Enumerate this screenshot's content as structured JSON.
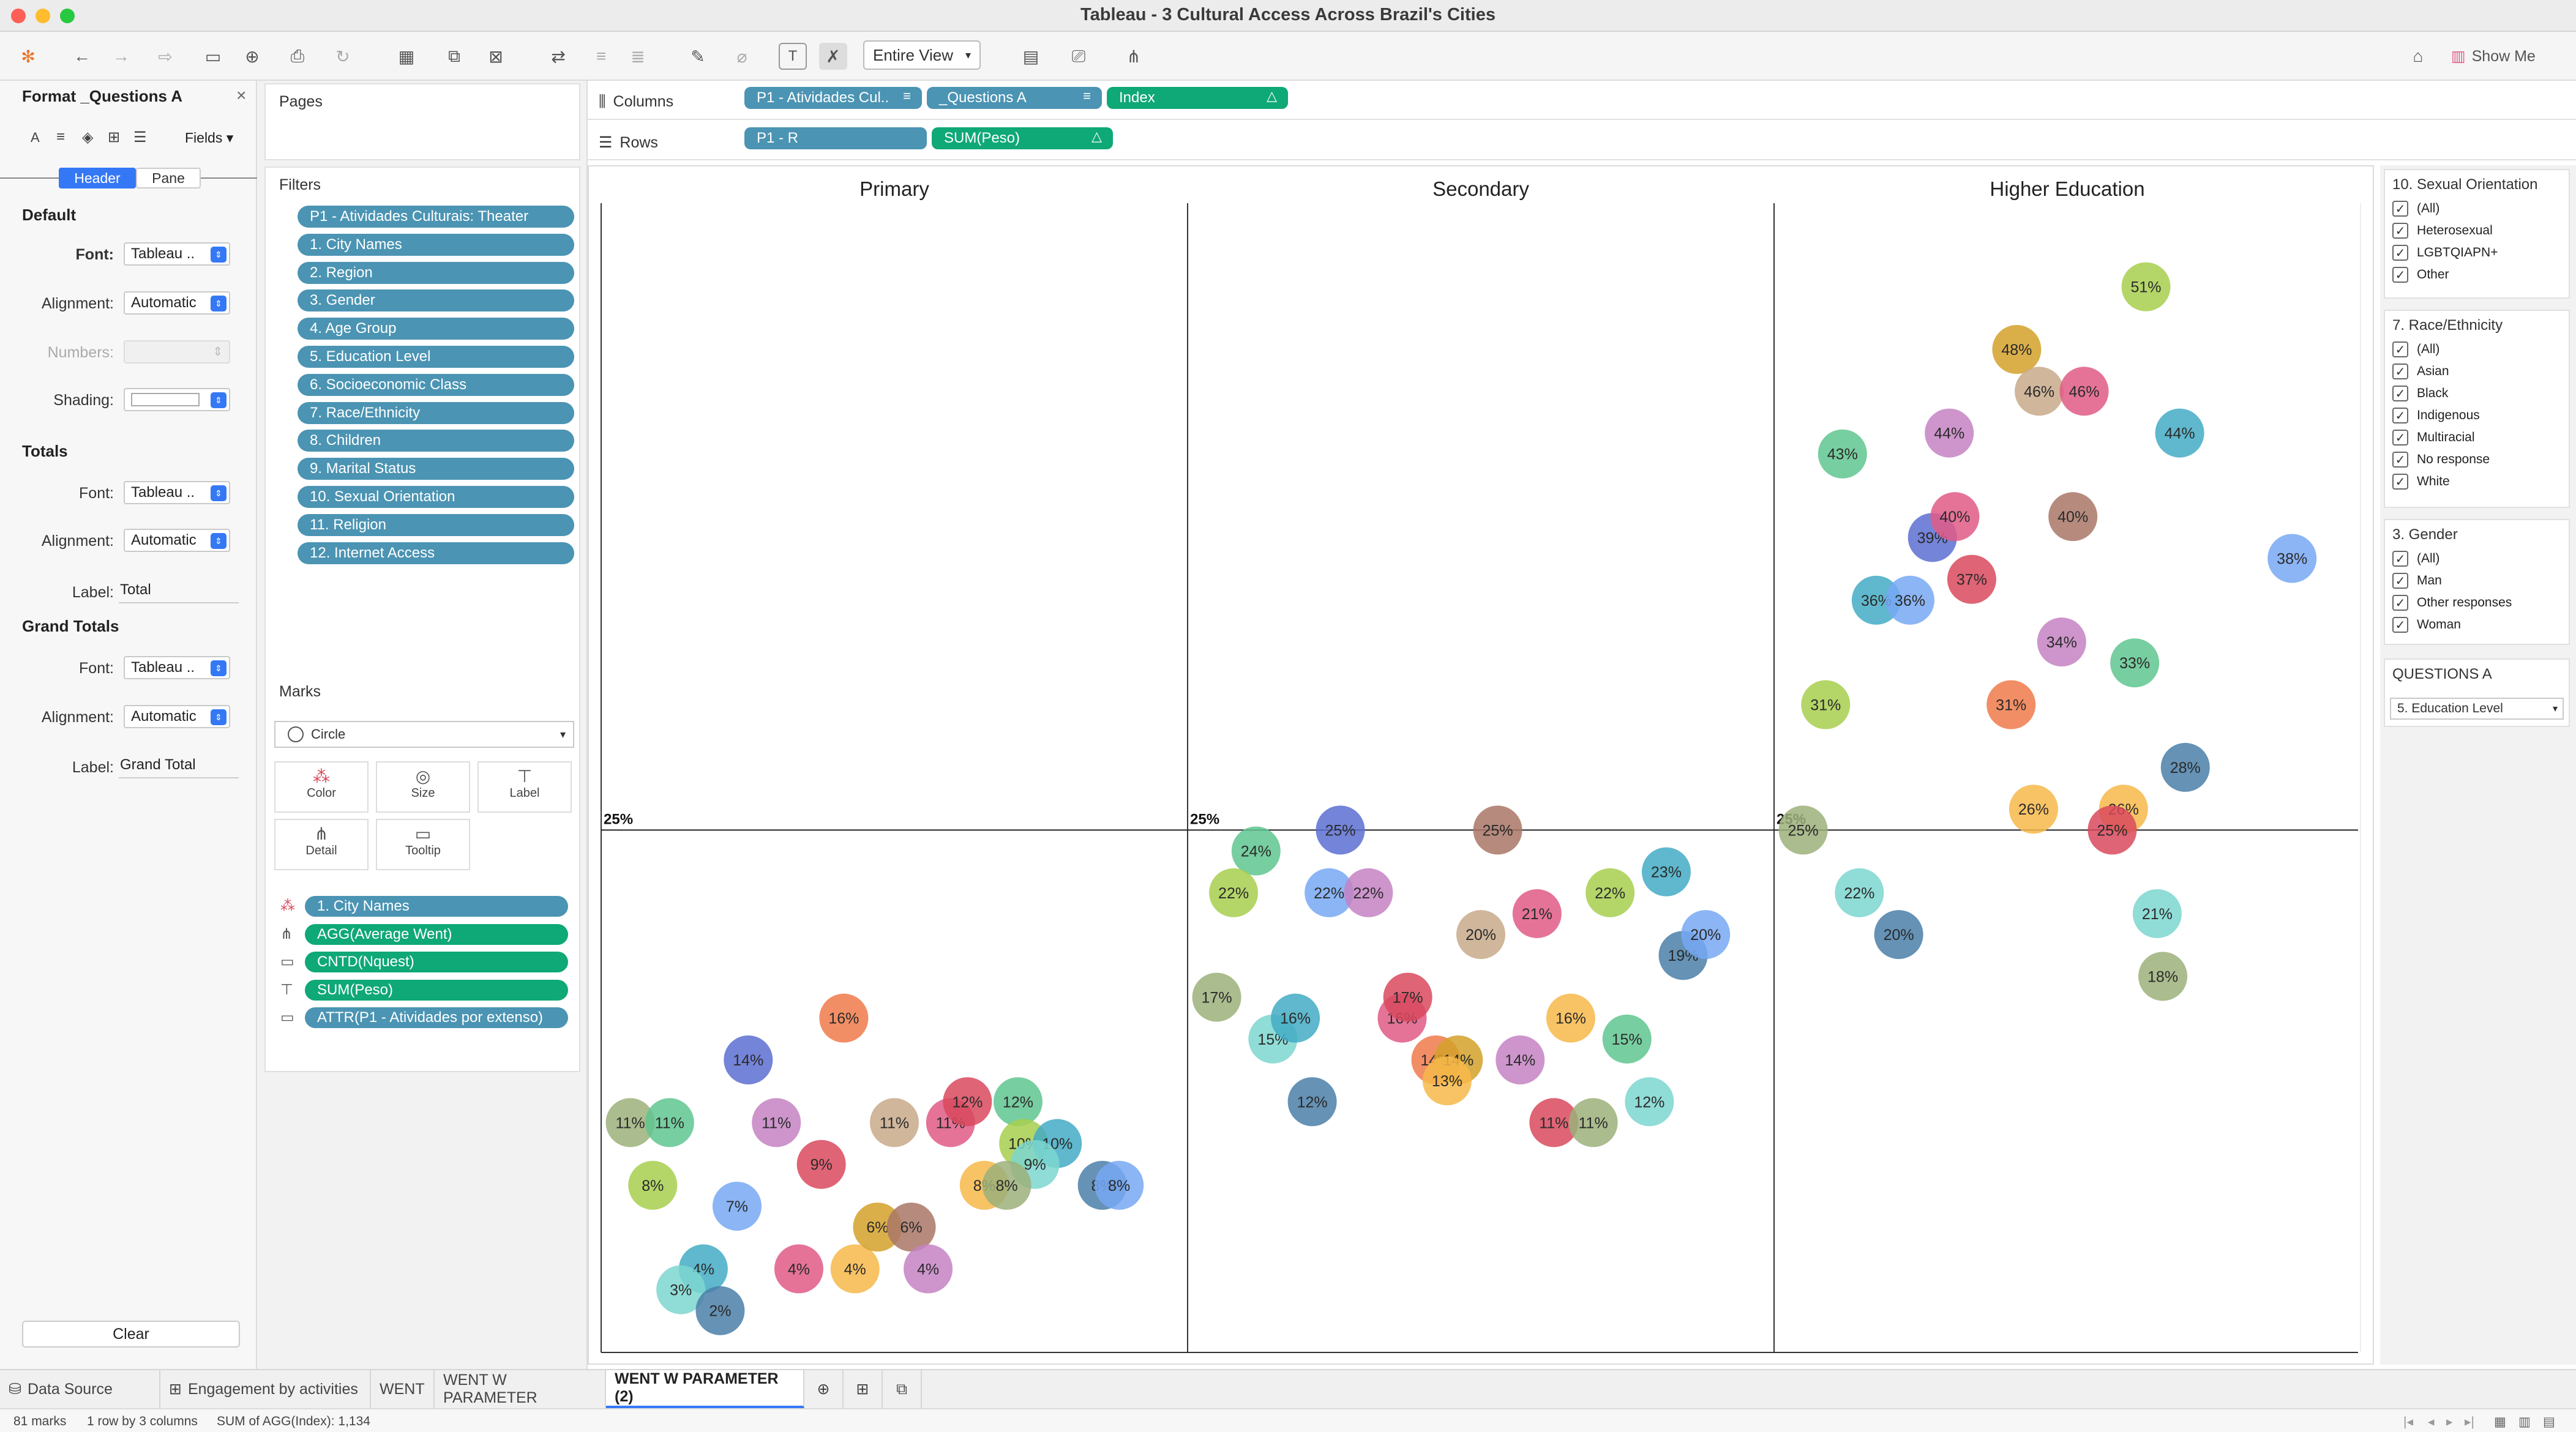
{
  "window": {
    "title": "Tableau - 3 Cultural Access Across Brazil's Cities"
  },
  "toolbar": {
    "view_select": "Entire View",
    "show_me": "Show Me"
  },
  "format_panel": {
    "title": "Format _Questions A",
    "fields_label": "Fields",
    "tabs": [
      "Header",
      "Pane"
    ],
    "default": {
      "heading": "Default",
      "font_label": "Font:",
      "font_value": "Tableau ..",
      "alignment_label": "Alignment:",
      "alignment_value": "Automatic",
      "numbers_label": "Numbers:",
      "shading_label": "Shading:"
    },
    "totals": {
      "heading": "Totals",
      "font_label": "Font:",
      "font_value": "Tableau ..",
      "alignment_label": "Alignment:",
      "alignment_value": "Automatic",
      "label_label": "Label:",
      "label_value": "Total"
    },
    "grand_totals": {
      "heading": "Grand Totals",
      "font_label": "Font:",
      "font_value": "Tableau ..",
      "alignment_label": "Alignment:",
      "alignment_value": "Automatic",
      "label_label": "Label:",
      "label_value": "Grand Total"
    },
    "clear_button": "Clear"
  },
  "pages": {
    "title": "Pages"
  },
  "filters": {
    "title": "Filters",
    "items": [
      "P1 - Atividades Culturais: Theater",
      "1. City Names",
      "2. Region",
      "3. Gender",
      "4. Age Group",
      "5. Education Level",
      "6. Socioeconomic Class",
      "7. Race/Ethnicity",
      "8. Children",
      "9. Marital Status",
      "10. Sexual Orientation",
      "11. Religion",
      "12. Internet Access"
    ]
  },
  "marks": {
    "title": "Marks",
    "type": "Circle",
    "buttons": [
      "Color",
      "Size",
      "Label",
      "Detail",
      "Tooltip"
    ],
    "fields": [
      "1. City Names",
      "AGG(Average Went)",
      "CNTD(Nquest)",
      "SUM(Peso)",
      "ATTR(P1 - Atividades por extenso)"
    ]
  },
  "shelves": {
    "columns_label": "Columns",
    "columns": [
      "P1 - Atividades Cul..",
      "_Questions A",
      "Index"
    ],
    "rows_label": "Rows",
    "rows": [
      "P1 - R",
      "SUM(Peso)"
    ]
  },
  "chart_data": {
    "type": "scatter",
    "panes": [
      "Primary",
      "Secondary",
      "Higher Education"
    ],
    "reference_line": {
      "value": 25,
      "label": "25%"
    },
    "ylim": [
      0,
      55
    ],
    "points": [
      {
        "pane": 0,
        "x": 0.03,
        "y": 11,
        "label": "11%",
        "color": "#9cb07a"
      },
      {
        "pane": 0,
        "x": 0.1,
        "y": 11,
        "label": "11%",
        "color": "#5fc58f"
      },
      {
        "pane": 0,
        "x": 0.07,
        "y": 8,
        "label": "8%",
        "color": "#a7cf4d"
      },
      {
        "pane": 0,
        "x": 0.24,
        "y": 14,
        "label": "14%",
        "color": "#5c6fd1"
      },
      {
        "pane": 0,
        "x": 0.41,
        "y": 16,
        "label": "16%",
        "color": "#f07a4a"
      },
      {
        "pane": 0,
        "x": 0.29,
        "y": 11,
        "label": "11%",
        "color": "#c483c3"
      },
      {
        "pane": 0,
        "x": 0.37,
        "y": 9,
        "label": "9%",
        "color": "#d9495d"
      },
      {
        "pane": 0,
        "x": 0.22,
        "y": 7,
        "label": "7%",
        "color": "#77a8f3"
      },
      {
        "pane": 0,
        "x": 0.16,
        "y": 4,
        "label": "4%",
        "color": "#43acc4"
      },
      {
        "pane": 0,
        "x": 0.12,
        "y": 3,
        "label": "3%",
        "color": "#7dd6d0"
      },
      {
        "pane": 0,
        "x": 0.19,
        "y": 2,
        "label": "2%",
        "color": "#4a7fa8"
      },
      {
        "pane": 0,
        "x": 0.33,
        "y": 4,
        "label": "4%",
        "color": "#e05a86"
      },
      {
        "pane": 0,
        "x": 0.43,
        "y": 4,
        "label": "4%",
        "color": "#f7b84a"
      },
      {
        "pane": 0,
        "x": 0.47,
        "y": 6,
        "label": "6%",
        "color": "#d4a12a"
      },
      {
        "pane": 0,
        "x": 0.53,
        "y": 6,
        "label": "6%",
        "color": "#a97766"
      },
      {
        "pane": 0,
        "x": 0.56,
        "y": 4,
        "label": "4%",
        "color": "#c483c3"
      },
      {
        "pane": 0,
        "x": 0.5,
        "y": 11,
        "label": "11%",
        "color": "#c8a98a"
      },
      {
        "pane": 0,
        "x": 0.6,
        "y": 11,
        "label": "11%",
        "color": "#e05a86"
      },
      {
        "pane": 0,
        "x": 0.63,
        "y": 12,
        "label": "12%",
        "color": "#d9495d"
      },
      {
        "pane": 0,
        "x": 0.72,
        "y": 12,
        "label": "12%",
        "color": "#5fc58f"
      },
      {
        "pane": 0,
        "x": 0.73,
        "y": 10,
        "label": "10%",
        "color": "#a7cf4d"
      },
      {
        "pane": 0,
        "x": 0.79,
        "y": 10,
        "label": "10%",
        "color": "#43acc4"
      },
      {
        "pane": 0,
        "x": 0.75,
        "y": 9,
        "label": "9%",
        "color": "#7dd6d0"
      },
      {
        "pane": 0,
        "x": 0.66,
        "y": 8,
        "label": "8%",
        "color": "#f7b84a"
      },
      {
        "pane": 0,
        "x": 0.7,
        "y": 8,
        "label": "8%",
        "color": "#9cb07a"
      },
      {
        "pane": 0,
        "x": 0.87,
        "y": 8,
        "label": "8%",
        "color": "#4a7fa8"
      },
      {
        "pane": 0,
        "x": 0.9,
        "y": 8,
        "label": "8%",
        "color": "#77a8f3"
      },
      {
        "pane": 1,
        "x": 0.03,
        "y": 17,
        "label": "17%",
        "color": "#9cb07a"
      },
      {
        "pane": 1,
        "x": 0.1,
        "y": 24,
        "label": "24%",
        "color": "#5fc58f"
      },
      {
        "pane": 1,
        "x": 0.06,
        "y": 22,
        "label": "22%",
        "color": "#a7cf4d"
      },
      {
        "pane": 1,
        "x": 0.25,
        "y": 25,
        "label": "25%",
        "color": "#5c6fd1"
      },
      {
        "pane": 1,
        "x": 0.53,
        "y": 25,
        "label": "25%",
        "color": "#a97766"
      },
      {
        "pane": 1,
        "x": 0.23,
        "y": 22,
        "label": "22%",
        "color": "#77a8f3"
      },
      {
        "pane": 1,
        "x": 0.3,
        "y": 22,
        "label": "22%",
        "color": "#c483c3"
      },
      {
        "pane": 1,
        "x": 0.13,
        "y": 15,
        "label": "15%",
        "color": "#7dd6d0"
      },
      {
        "pane": 1,
        "x": 0.17,
        "y": 16,
        "label": "16%",
        "color": "#43acc4"
      },
      {
        "pane": 1,
        "x": 0.2,
        "y": 12,
        "label": "12%",
        "color": "#4a7fa8"
      },
      {
        "pane": 1,
        "x": 0.36,
        "y": 16,
        "label": "16%",
        "color": "#e05a86"
      },
      {
        "pane": 1,
        "x": 0.37,
        "y": 17,
        "label": "17%",
        "color": "#d9495d"
      },
      {
        "pane": 1,
        "x": 0.42,
        "y": 14,
        "label": "14%",
        "color": "#f07a4a"
      },
      {
        "pane": 1,
        "x": 0.46,
        "y": 14,
        "label": "14%",
        "color": "#d4a12a"
      },
      {
        "pane": 1,
        "x": 0.44,
        "y": 13,
        "label": "13%",
        "color": "#f7b84a"
      },
      {
        "pane": 1,
        "x": 0.5,
        "y": 20,
        "label": "20%",
        "color": "#c8a98a"
      },
      {
        "pane": 1,
        "x": 0.6,
        "y": 21,
        "label": "21%",
        "color": "#e05a86"
      },
      {
        "pane": 1,
        "x": 0.57,
        "y": 14,
        "label": "14%",
        "color": "#c483c3"
      },
      {
        "pane": 1,
        "x": 0.66,
        "y": 16,
        "label": "16%",
        "color": "#f7b84a"
      },
      {
        "pane": 1,
        "x": 0.63,
        "y": 11,
        "label": "11%",
        "color": "#d9495d"
      },
      {
        "pane": 1,
        "x": 0.7,
        "y": 11,
        "label": "11%",
        "color": "#9cb07a"
      },
      {
        "pane": 1,
        "x": 0.73,
        "y": 22,
        "label": "22%",
        "color": "#a7cf4d"
      },
      {
        "pane": 1,
        "x": 0.76,
        "y": 15,
        "label": "15%",
        "color": "#5fc58f"
      },
      {
        "pane": 1,
        "x": 0.8,
        "y": 12,
        "label": "12%",
        "color": "#7dd6d0"
      },
      {
        "pane": 1,
        "x": 0.83,
        "y": 23,
        "label": "23%",
        "color": "#43acc4"
      },
      {
        "pane": 1,
        "x": 0.86,
        "y": 19,
        "label": "19%",
        "color": "#4a7fa8"
      },
      {
        "pane": 1,
        "x": 0.9,
        "y": 20,
        "label": "20%",
        "color": "#77a8f3"
      },
      {
        "pane": 2,
        "x": 0.03,
        "y": 25,
        "label": "25%",
        "color": "#9cb07a"
      },
      {
        "pane": 2,
        "x": 0.1,
        "y": 43,
        "label": "43%",
        "color": "#5fc58f"
      },
      {
        "pane": 2,
        "x": 0.07,
        "y": 31,
        "label": "31%",
        "color": "#a7cf4d"
      },
      {
        "pane": 2,
        "x": 0.16,
        "y": 36,
        "label": "36%",
        "color": "#43acc4"
      },
      {
        "pane": 2,
        "x": 0.22,
        "y": 36,
        "label": "36%",
        "color": "#77a8f3"
      },
      {
        "pane": 2,
        "x": 0.13,
        "y": 22,
        "label": "22%",
        "color": "#7dd6d0"
      },
      {
        "pane": 2,
        "x": 0.2,
        "y": 20,
        "label": "20%",
        "color": "#4a7fa8"
      },
      {
        "pane": 2,
        "x": 0.26,
        "y": 39,
        "label": "39%",
        "color": "#5c6fd1"
      },
      {
        "pane": 2,
        "x": 0.3,
        "y": 40,
        "label": "40%",
        "color": "#e05a86"
      },
      {
        "pane": 2,
        "x": 0.33,
        "y": 37,
        "label": "37%",
        "color": "#d9495d"
      },
      {
        "pane": 2,
        "x": 0.29,
        "y": 44,
        "label": "44%",
        "color": "#c483c3"
      },
      {
        "pane": 2,
        "x": 0.41,
        "y": 48,
        "label": "48%",
        "color": "#d4a12a"
      },
      {
        "pane": 2,
        "x": 0.45,
        "y": 46,
        "label": "46%",
        "color": "#c8a98a"
      },
      {
        "pane": 2,
        "x": 0.53,
        "y": 46,
        "label": "46%",
        "color": "#e05a86"
      },
      {
        "pane": 2,
        "x": 0.51,
        "y": 40,
        "label": "40%",
        "color": "#a97766"
      },
      {
        "pane": 2,
        "x": 0.4,
        "y": 31,
        "label": "31%",
        "color": "#f07a4a"
      },
      {
        "pane": 2,
        "x": 0.49,
        "y": 34,
        "label": "34%",
        "color": "#c483c3"
      },
      {
        "pane": 2,
        "x": 0.44,
        "y": 26,
        "label": "26%",
        "color": "#f7b84a"
      },
      {
        "pane": 2,
        "x": 0.64,
        "y": 51,
        "label": "51%",
        "color": "#a7cf4d"
      },
      {
        "pane": 2,
        "x": 0.62,
        "y": 33,
        "label": "33%",
        "color": "#5fc58f"
      },
      {
        "pane": 2,
        "x": 0.66,
        "y": 21,
        "label": "21%",
        "color": "#7dd6d0"
      },
      {
        "pane": 2,
        "x": 0.7,
        "y": 44,
        "label": "44%",
        "color": "#43acc4"
      },
      {
        "pane": 2,
        "x": 0.71,
        "y": 28,
        "label": "28%",
        "color": "#4a7fa8"
      },
      {
        "pane": 2,
        "x": 0.67,
        "y": 18,
        "label": "18%",
        "color": "#9cb07a"
      },
      {
        "pane": 2,
        "x": 0.6,
        "y": 26,
        "label": "26%",
        "color": "#f7b84a"
      },
      {
        "pane": 2,
        "x": 0.58,
        "y": 25,
        "label": "25%",
        "color": "#d9495d"
      },
      {
        "pane": 2,
        "x": 0.9,
        "y": 38,
        "label": "38%",
        "color": "#77a8f3"
      }
    ]
  },
  "legends": [
    {
      "title": "10. Sexual Orientation",
      "items": [
        "(All)",
        "Heterosexual",
        "LGBTQIAPN+",
        "Other"
      ]
    },
    {
      "title": "7. Race/Ethnicity",
      "items": [
        "(All)",
        "Asian",
        "Black",
        "Indigenous",
        "Multiracial",
        "No response",
        "White"
      ]
    },
    {
      "title": "3. Gender",
      "items": [
        "(All)",
        "Man",
        "Other responses",
        "Woman"
      ]
    }
  ],
  "parameter": {
    "title": "QUESTIONS A",
    "value": "5. Education Level"
  },
  "tabs": [
    "Data Source",
    "Engagement by activities",
    "WENT",
    "WENT W PARAMETER",
    "WENT W PARAMETER (2)"
  ],
  "status": {
    "marks": "81 marks",
    "layout": "1 row by 3 columns",
    "sum": "SUM of AGG(Index): 1,134"
  }
}
